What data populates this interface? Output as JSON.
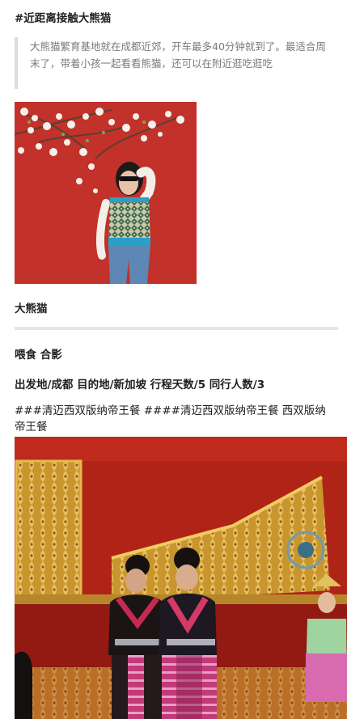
{
  "post": {
    "heading_tag": "#近距离接触大熊猫",
    "quote_text": "大熊猫繁育基地就在成都近郊，开车最多40分钟就到了。最适合周末了，带着小孩一起看看熊猫，还可以在附近逛吃逛吃",
    "section_title": "大熊猫",
    "activities": "喂食 合影",
    "trip_info": "出发地/成都 目的地/新加坡 行程天数/5 同行人数/3",
    "restaurant_heading": "###清迈西双版纳帝王餐 ####清迈西双版纳帝王餐 西双版纳帝王餐"
  },
  "colors": {
    "quote_bar": "#dcdcdc",
    "quote_text": "#7a7a7a",
    "divider": "#e6e6e6",
    "wall_red": "#c8342c",
    "stage_red": "#b02418",
    "gold": "#d4a437"
  },
  "images": {
    "panda_photo": "woman-in-patterned-vest-before-red-wall-with-blossoms",
    "dance_photo": "two-performers-in-traditional-costume-on-red-and-gold-stage"
  }
}
